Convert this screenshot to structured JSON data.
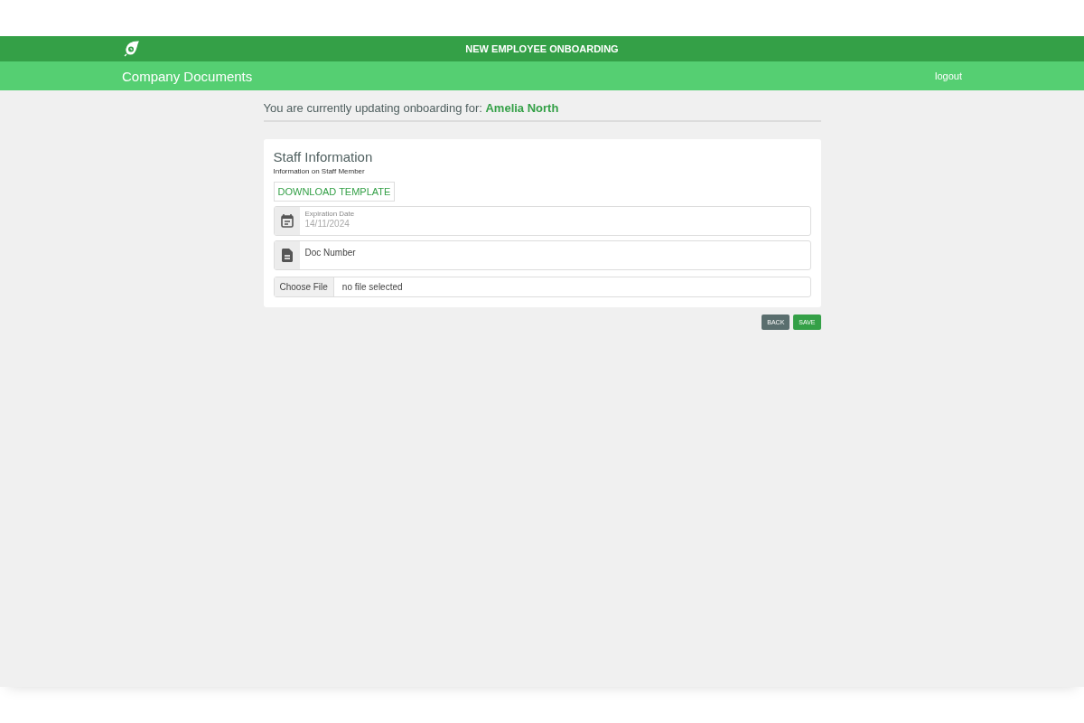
{
  "header": {
    "title": "NEW EMPLOYEE ONBOARDING",
    "section": "Company Documents",
    "logout": "logout"
  },
  "context": {
    "prefix": "You are currently updating onboarding for:",
    "name": "Amelia North"
  },
  "card": {
    "title": "Staff Information",
    "subtitle": "Information on Staff Member",
    "download_button": "DOWNLOAD TEMPLATE",
    "fields": [
      {
        "kind": "date",
        "label": "Expiration Date",
        "value": "14/11/2024"
      },
      {
        "kind": "text",
        "label": "Doc Number"
      }
    ],
    "file": {
      "button": "Choose File",
      "status": "no file selected"
    }
  },
  "buttons": [
    {
      "kind": "back",
      "label": "BACK"
    },
    {
      "kind": "save",
      "label": "SAVE"
    }
  ]
}
